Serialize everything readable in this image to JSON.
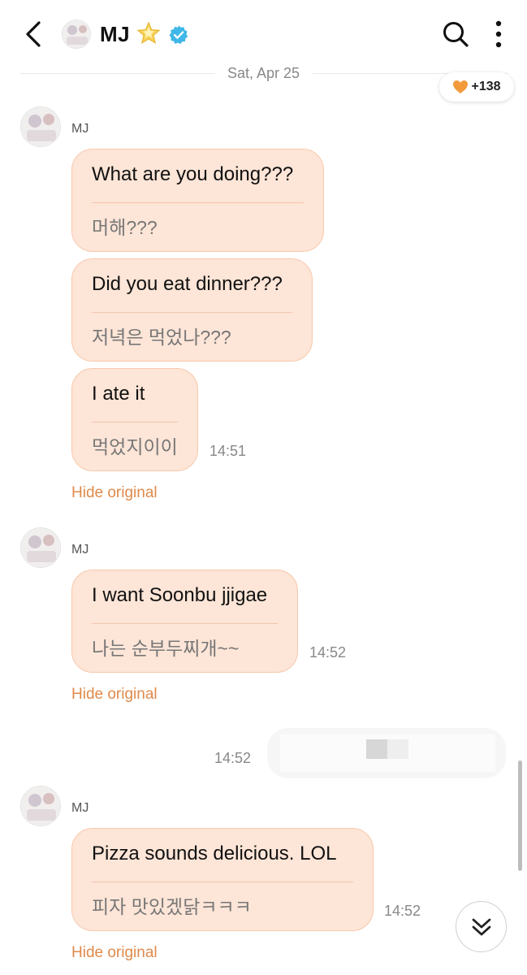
{
  "header": {
    "name": "MJ"
  },
  "date_label": "Sat, Apr 25",
  "hearts": "+138",
  "groups": [
    {
      "sender": "MJ",
      "messages": [
        {
          "translated": "What are you doing???",
          "original": "머해???"
        },
        {
          "translated": "Did you eat dinner???",
          "original": "저녁은 먹었나???"
        },
        {
          "translated": "I ate it",
          "original": "먹었지이이"
        }
      ],
      "time": "14:51",
      "hide_label": "Hide original"
    },
    {
      "sender": "MJ",
      "messages": [
        {
          "translated": "I want Soonbu jjigae",
          "original": "나는 순부두찌개~~"
        }
      ],
      "time": "14:52",
      "hide_label": "Hide original"
    },
    {
      "sender": "MJ",
      "messages": [
        {
          "translated": "Pizza sounds delicious. LOL",
          "original": "피자 맛있겠닭ㅋㅋㅋ"
        }
      ],
      "time": "14:52",
      "hide_label": "Hide original"
    }
  ],
  "sent": {
    "time": "14:52"
  },
  "colors": {
    "bubble_fill": "#fde5d7",
    "bubble_border": "#f8c9ad",
    "accent_orange": "#e08a4a",
    "heart": "#f39a3c",
    "verified": "#3fb7e8"
  },
  "icons": {
    "back": "chevron-left-icon",
    "star": "star-icon",
    "verified": "verified-badge-icon",
    "search": "search-icon",
    "more": "more-vertical-icon",
    "heart": "heart-icon",
    "scroll_down": "double-chevron-down-icon"
  }
}
